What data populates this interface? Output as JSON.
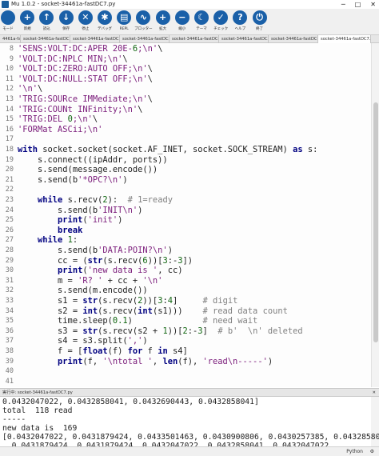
{
  "window": {
    "title": "Mu 1.0.2 - socket-34461a-fastDC7.py",
    "min": "─",
    "max": "□",
    "close": "✕"
  },
  "toolbar": [
    {
      "name": "mode-button",
      "icon": "mode-icon",
      "glyph": "",
      "label": "モード"
    },
    {
      "name": "new-button",
      "icon": "plus-icon",
      "glyph": "+",
      "label": "新規"
    },
    {
      "name": "load-button",
      "icon": "upload-icon",
      "glyph": "↑",
      "label": "読込"
    },
    {
      "name": "save-button",
      "icon": "download-icon",
      "glyph": "↓",
      "label": "保存"
    },
    {
      "name": "stop-button",
      "icon": "stop-icon",
      "glyph": "✕",
      "label": "停止"
    },
    {
      "name": "debug-button",
      "icon": "bug-icon",
      "glyph": "✱",
      "label": "デバッグ"
    },
    {
      "name": "repl-button",
      "icon": "keyboard-icon",
      "glyph": "▤",
      "label": "REPL"
    },
    {
      "name": "plotter-button",
      "icon": "wave-icon",
      "glyph": "∿",
      "label": "プロッター"
    },
    {
      "name": "zoom-in-button",
      "icon": "zoom-in-icon",
      "glyph": "+",
      "label": "拡大"
    },
    {
      "name": "zoom-out-button",
      "icon": "zoom-out-icon",
      "glyph": "−",
      "label": "縮小"
    },
    {
      "name": "theme-button",
      "icon": "moon-icon",
      "glyph": "☾",
      "label": "テーマ"
    },
    {
      "name": "check-button",
      "icon": "thumbs-up-icon",
      "glyph": "✓",
      "label": "チェック"
    },
    {
      "name": "help-button",
      "icon": "help-icon",
      "glyph": "?",
      "label": "ヘルプ"
    },
    {
      "name": "quit-button",
      "icon": "power-icon",
      "glyph": "⏻",
      "label": "終了"
    }
  ],
  "tabs": [
    {
      "label": "4461a-fa.py",
      "active": false
    },
    {
      "label": "socket-34461a-fastDC.py",
      "active": false
    },
    {
      "label": "socket-34461a-fastDC2.py",
      "active": false
    },
    {
      "label": "socket-34461a-fastDC3.py",
      "active": false
    },
    {
      "label": "socket-34461a-fastDC4.py",
      "active": false
    },
    {
      "label": "socket-34461a-fastDC5.py",
      "active": false
    },
    {
      "label": "socket-34461a-fastDC6.py",
      "active": false
    },
    {
      "label": "socket-34461a-fastDC7.py",
      "active": true
    }
  ],
  "tab_close": "✕",
  "editor": {
    "lines": [
      {
        "n": "8",
        "text": "'SENS:VOLT:DC:APER 20E-6;\\n'\\"
      },
      {
        "n": "9",
        "text": "'VOLT:DC:NPLC MIN;\\n'\\"
      },
      {
        "n": "10",
        "text": "'VOLT:DC:ZERO:AUTO OFF;\\n'\\"
      },
      {
        "n": "11",
        "text": "'VOLT:DC:NULL:STAT OFF;\\n'\\"
      },
      {
        "n": "12",
        "text": "'\\n'\\"
      },
      {
        "n": "13",
        "text": "'TRIG:SOURce IMMediate;\\n'\\"
      },
      {
        "n": "14",
        "text": "'TRIG:COUNt INFinity;\\n'\\"
      },
      {
        "n": "15",
        "text": "'TRIG:DEL 0;\\n'\\"
      },
      {
        "n": "16",
        "text": "'FORMat ASCii;\\n'"
      },
      {
        "n": "17",
        "text": ""
      },
      {
        "n": "18",
        "text": "with socket.socket(socket.AF_INET, socket.SOCK_STREAM) as s:"
      },
      {
        "n": "19",
        "text": "    s.connect((ipAddr, ports))"
      },
      {
        "n": "20",
        "text": "    s.send(message.encode())"
      },
      {
        "n": "21",
        "text": "    s.send(b'*OPC?\\n')"
      },
      {
        "n": "22",
        "text": ""
      },
      {
        "n": "23",
        "text": "    while s.recv(2):  # 1=ready"
      },
      {
        "n": "24",
        "text": "        s.send(b'INIT\\n')"
      },
      {
        "n": "25",
        "text": "        print('init')"
      },
      {
        "n": "26",
        "text": "        break"
      },
      {
        "n": "27",
        "text": "    while 1:"
      },
      {
        "n": "28",
        "text": "        s.send(b'DATA:POIN?\\n')"
      },
      {
        "n": "29",
        "text": "        cc = (str(s.recv(6))[3:-3])"
      },
      {
        "n": "30",
        "text": "        print('new data is ', cc)"
      },
      {
        "n": "31",
        "text": "        m = 'R? ' + cc + '\\n'"
      },
      {
        "n": "32",
        "text": "        s.send(m.encode())"
      },
      {
        "n": "33",
        "text": "        s1 = str(s.recv(2))[3:4]     # digit"
      },
      {
        "n": "34",
        "text": "        s2 = int(s.recv(int(s1)))    # read data count"
      },
      {
        "n": "35",
        "text": "        time.sleep(0.1)              # need wait"
      },
      {
        "n": "36",
        "text": "        s3 = str(s.recv(s2 + 1))[2:-3]  # b'  \\n' deleted"
      },
      {
        "n": "37",
        "text": "        s4 = s3.split(',')"
      },
      {
        "n": "38",
        "text": "        f = [float(f) for f in s4]"
      },
      {
        "n": "39",
        "text": "        print(f, '\\ntotal ', len(f), 'read\\n-----')"
      },
      {
        "n": "40",
        "text": ""
      },
      {
        "n": "41",
        "text": ""
      }
    ]
  },
  "repl": {
    "header": "実行中: socket-34461a-fastDC7.py",
    "lines": [
      "0.0432047022, 0.0432858041, 0.0432690443, 0.0432858041]",
      "total  118 read",
      "-----",
      "new data is  169",
      "[0.0432047022, 0.0431879424, 0.0433501463, 0.0430900806, 0.0430257385, 0.0432858041,",
      "  0.0431879424, 0.0431879424, 0.0432047022, 0.0432858041, 0.0432047022"
    ]
  },
  "status": {
    "mode": "Python",
    "gear": "⚙"
  }
}
